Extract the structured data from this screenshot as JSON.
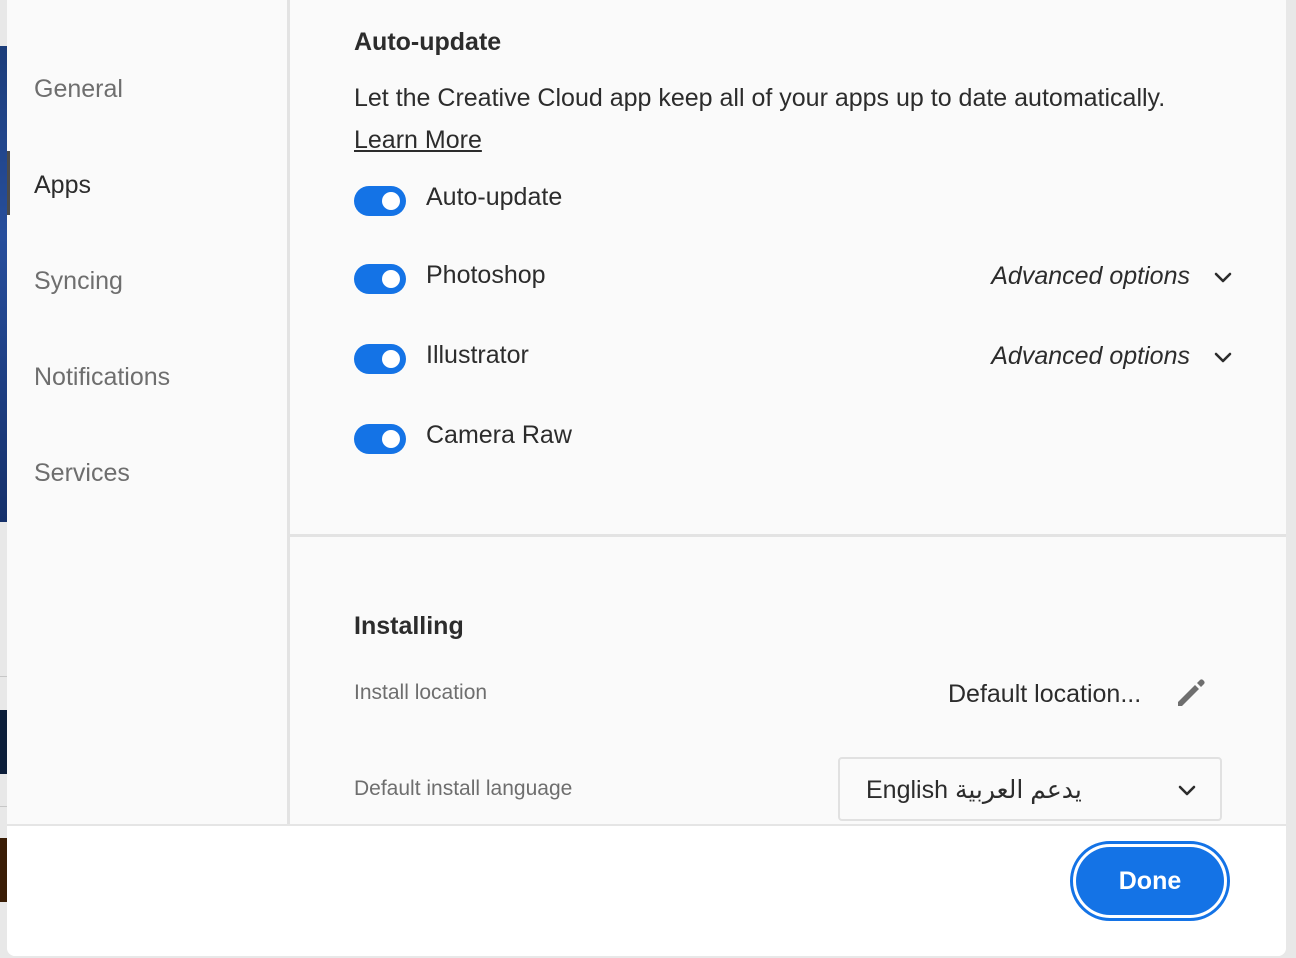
{
  "sidebar": {
    "items": [
      {
        "label": "General",
        "active": false
      },
      {
        "label": "Apps",
        "active": true
      },
      {
        "label": "Syncing",
        "active": false
      },
      {
        "label": "Notifications",
        "active": false
      },
      {
        "label": "Services",
        "active": false
      }
    ]
  },
  "auto_update": {
    "title": "Auto-update",
    "description": "Let the Creative Cloud app keep all of your apps up to date automatically.",
    "learn_more": "Learn More",
    "toggles": [
      {
        "label": "Auto-update",
        "on": true,
        "advanced": ""
      },
      {
        "label": "Photoshop",
        "on": true,
        "advanced": "Advanced options"
      },
      {
        "label": "Illustrator",
        "on": true,
        "advanced": "Advanced options"
      },
      {
        "label": "Camera Raw",
        "on": true,
        "advanced": ""
      }
    ]
  },
  "installing": {
    "title": "Installing",
    "location_label": "Install location",
    "location_value": "Default location...",
    "language_label": "Default install language",
    "language_value": "English يدعم العربية"
  },
  "footer": {
    "done_label": "Done"
  },
  "colors": {
    "accent": "#1473e6",
    "background": "#fafafa"
  },
  "icons": {
    "chevron": "chevron-down-icon",
    "edit": "pencil-icon"
  }
}
